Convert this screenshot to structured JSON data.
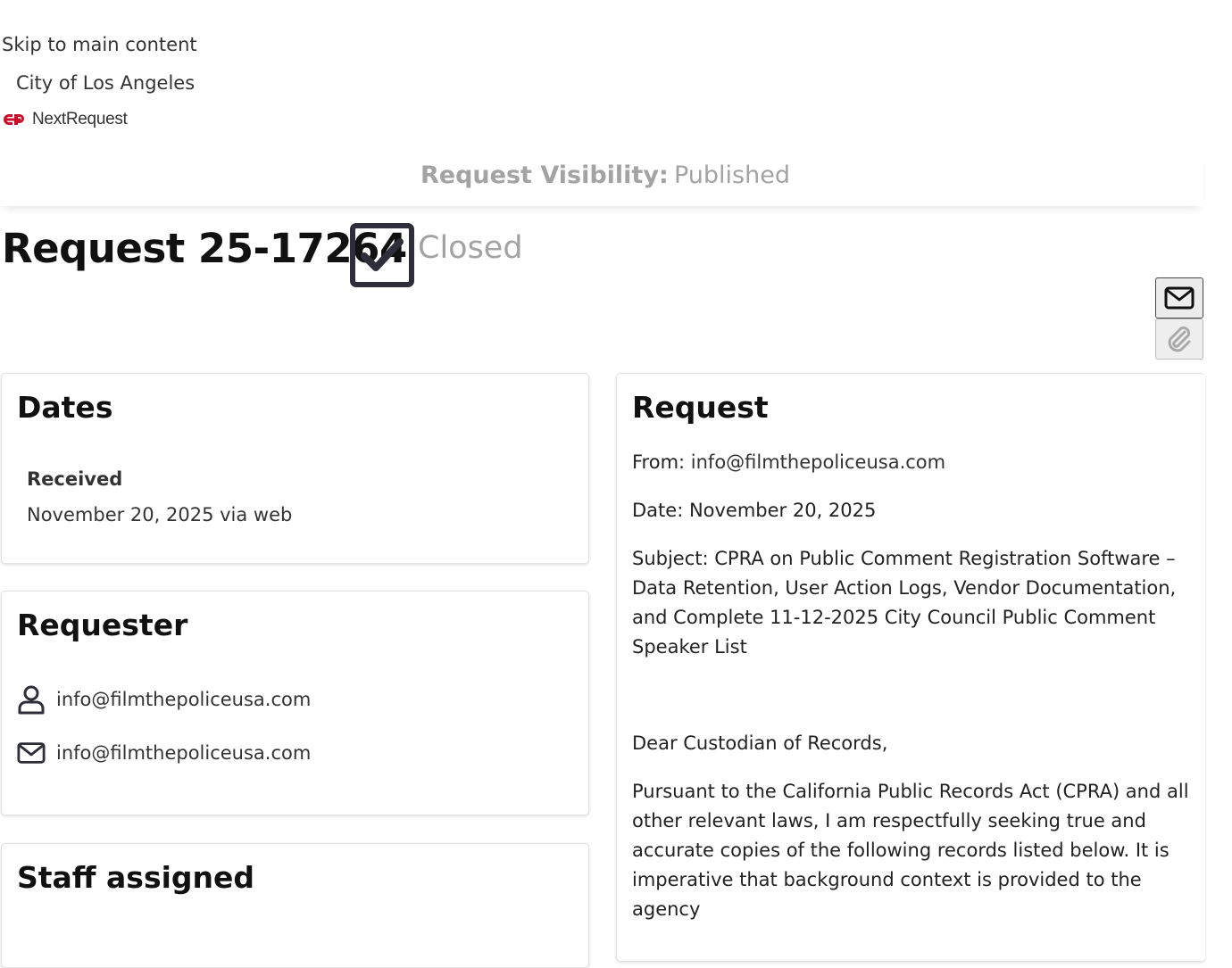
{
  "header": {
    "skip_link": "Skip to main content",
    "city_name": "City of Los Angeles",
    "brand_name": "NextRequest",
    "brand_color": "#c8102e"
  },
  "visibility": {
    "label": "Request Visibility:",
    "value": "Published"
  },
  "request_header": {
    "title": "Request 25-17264",
    "status": "Closed",
    "status_icon": "checkbox-checked-icon"
  },
  "actions": {
    "email_icon": "envelope-icon",
    "attach_icon": "paperclip-icon"
  },
  "dates": {
    "heading": "Dates",
    "received_label": "Received",
    "received_value": "November 20, 2025 via web"
  },
  "requester": {
    "heading": "Requester",
    "name": "info@filmthepoliceusa.com",
    "email": "info@filmthepoliceusa.com"
  },
  "staff": {
    "heading": "Staff assigned"
  },
  "request": {
    "heading": "Request",
    "from_label": "From: ",
    "from_value": "info@filmthepoliceusa.com",
    "date_line": "Date: November 20, 2025",
    "subject_line": "Subject: CPRA on Public Comment Registration Software – Data Retention, User Action Logs, Vendor Documentation, and Complete 11-12-2025 City Council Public Comment Speaker List",
    "greeting": "Dear Custodian of Records,",
    "body": "Pursuant to the California Public Records Act (CPRA) and all other relevant laws, I am respectfully seeking true and accurate copies of the following records listed below. It is imperative that background context is provided to the agency"
  }
}
